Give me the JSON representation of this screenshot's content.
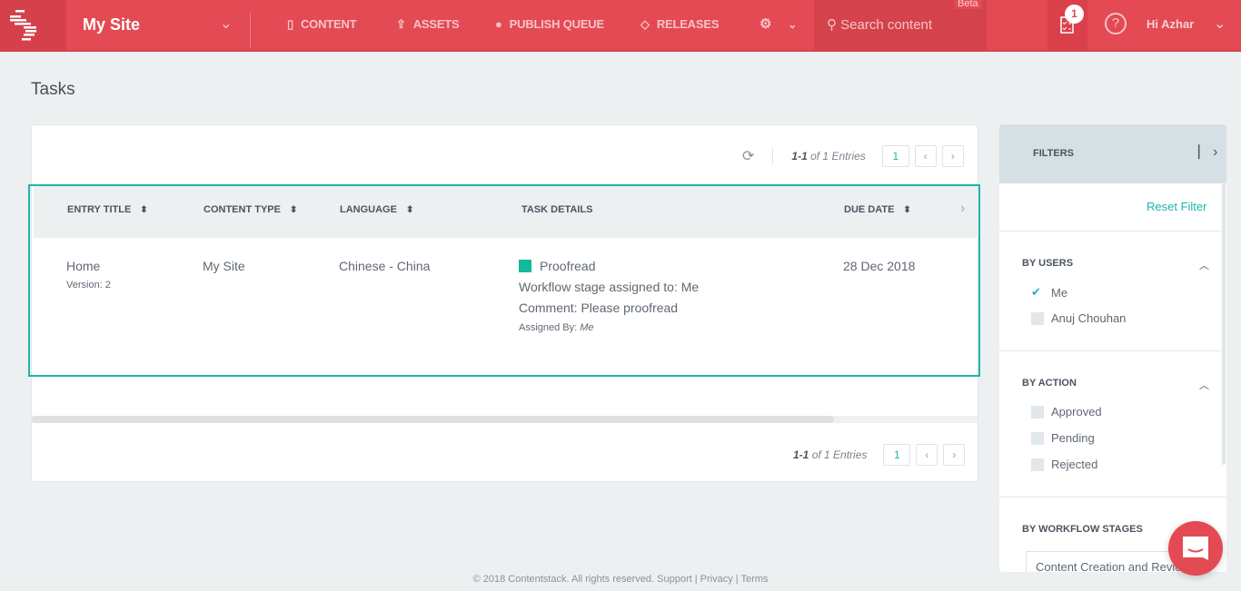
{
  "header": {
    "site_name": "My Site",
    "nav": [
      {
        "label": "CONTENT",
        "icon": "document-icon"
      },
      {
        "label": "ASSETS",
        "icon": "upload-icon"
      },
      {
        "label": "PUBLISH QUEUE",
        "icon": "globe-icon"
      },
      {
        "label": "RELEASES",
        "icon": "graduation-cap-icon"
      }
    ],
    "search_placeholder": "Search content",
    "beta": "Beta",
    "task_count": "1",
    "help": "?",
    "greeting": "Hi  Azhar"
  },
  "page": {
    "title": "Tasks"
  },
  "pagination": {
    "range": "1-1",
    "of": "of 1 Entries",
    "page": "1",
    "prev": "‹",
    "next": "›"
  },
  "table": {
    "columns": [
      "ENTRY TITLE",
      "CONTENT TYPE",
      "LANGUAGE",
      "TASK DETAILS",
      "DUE DATE"
    ],
    "rows": [
      {
        "title": "Home",
        "version": "Version: 2",
        "content_type": "My Site",
        "language": "Chinese - China",
        "stage": "Proofread",
        "stage_color": "#12b99c",
        "assigned_to": "Workflow stage assigned to: Me",
        "comment": "Comment: Please proofread",
        "assigned_by_label": "Assigned By:",
        "assigned_by": "Me",
        "due_date": "28 Dec 2018"
      }
    ]
  },
  "filters": {
    "title": "FILTERS",
    "reset": "Reset Filter",
    "by_users": {
      "label": "BY USERS",
      "options": [
        {
          "label": "Me",
          "checked": true
        },
        {
          "label": "Anuj Chouhan",
          "checked": false
        }
      ]
    },
    "by_action": {
      "label": "BY ACTION",
      "options": [
        "Approved",
        "Pending",
        "Rejected"
      ]
    },
    "by_workflow": {
      "label": "BY WORKFLOW STAGES",
      "value": "Content Creation and Review"
    }
  },
  "footer": "© 2018 Contentstack. All rights reserved. Support | Privacy | Terms",
  "colors": {
    "brand": "#e34a53",
    "accent": "#1fb5ac"
  }
}
